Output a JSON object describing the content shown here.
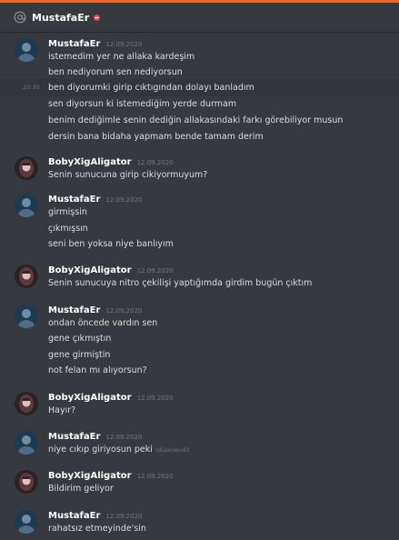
{
  "header": {
    "dm_name": "MustafaEr"
  },
  "colors": {
    "accent": "#f26522",
    "dnd": "#ed4245",
    "background": "#36393f",
    "username": "#ffffff",
    "message_text": "#dcddde",
    "muted": "#72767d"
  },
  "groups": [
    {
      "author": "MustafaEr",
      "timestamp": "12.09.2020",
      "avatar": "mustafa",
      "lines": [
        "istemedim yer ne allaka kardeşim",
        "ben nediyorum sen nediyorsun",
        "ben diyorumki girip cıktıgından dolayı banladım",
        "sen diyorsun ki istemediğim yerde durmam",
        "benim dediğimle senin dediğin allakasındaki farkı görebiliyor musun",
        "dersin bana bidaha yapmam bende tamam derim"
      ],
      "hover_time": "20:35"
    },
    {
      "author": "BobyXigAligator",
      "timestamp": "12.09.2020",
      "avatar": "boby",
      "lines": [
        "Senin sunucuna  girip cikiyormuyum?"
      ]
    },
    {
      "author": "MustafaEr",
      "timestamp": "12.09.2020",
      "avatar": "mustafa",
      "lines": [
        "girmişsin",
        "çıkmışsın",
        "seni ben yoksa niye banlıyım"
      ]
    },
    {
      "author": "BobyXigAligator",
      "timestamp": "12.09.2020",
      "avatar": "boby",
      "lines": [
        "Senin sunucuya  nitro çekilişi  yaptığımda  girdim  bugün çıktım"
      ]
    },
    {
      "author": "MustafaEr",
      "timestamp": "12.09.2020",
      "avatar": "mustafa",
      "lines": [
        "ondan öncede vardın sen",
        "gene çıkmıştın",
        "gene girmiştin",
        "not felan mı alıyorsun?"
      ]
    },
    {
      "author": "BobyXigAligator",
      "timestamp": "12.09.2020",
      "avatar": "boby",
      "lines": [
        "Hayır?"
      ]
    },
    {
      "author": "MustafaEr",
      "timestamp": "12.09.2020",
      "avatar": "mustafa",
      "lines": [
        "niye cıkıp giriyosun peki"
      ],
      "edited": "(düzenlendi)"
    },
    {
      "author": "BobyXigAligator",
      "timestamp": "12.09.2020",
      "avatar": "boby",
      "lines": [
        "Bildirim geliyor"
      ]
    },
    {
      "author": "MustafaEr",
      "timestamp": "12.09.2020",
      "avatar": "mustafa",
      "lines": [
        "rahatsız etmeyinde'sin"
      ]
    }
  ]
}
